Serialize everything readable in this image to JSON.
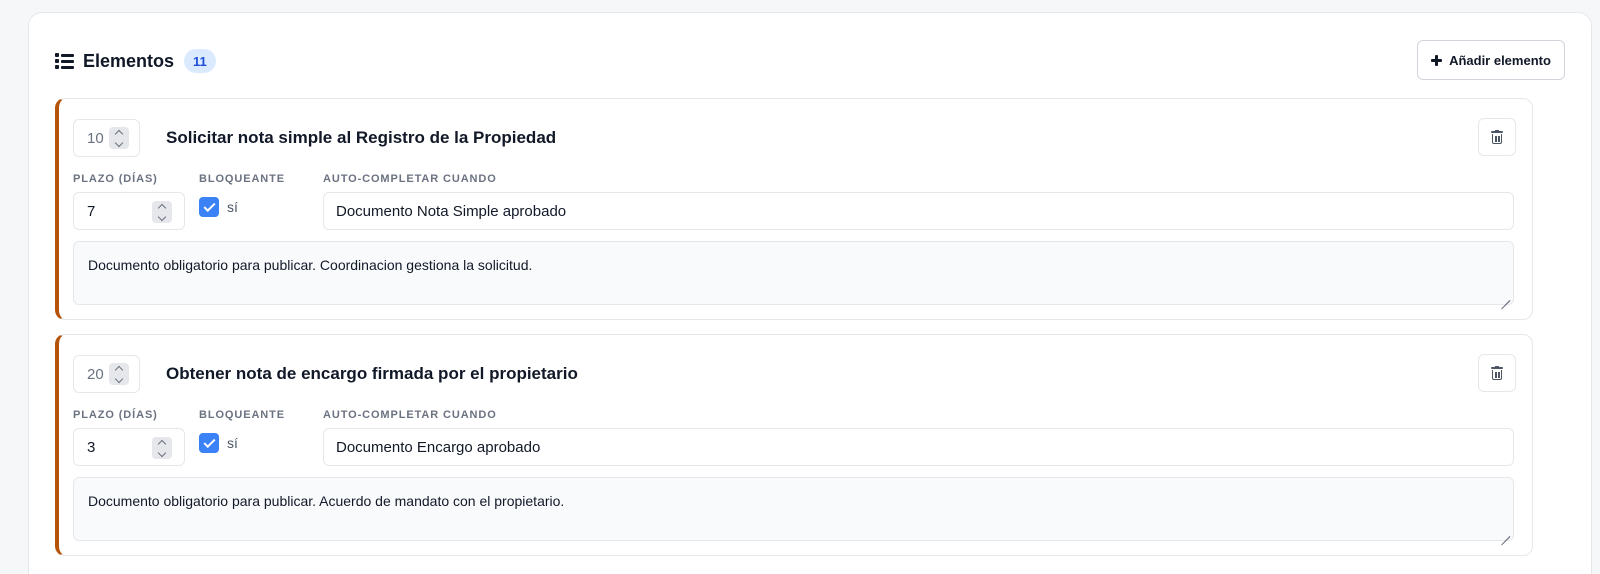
{
  "header": {
    "title": "Elementos",
    "count": "11",
    "add_label": "Añadir elemento",
    "icon": "list-icon"
  },
  "labels": {
    "plazo": "PLAZO (DÍAS)",
    "bloqueante": "BLOQUEANTE",
    "auto": "AUTO-COMPLETAR CUANDO"
  },
  "items": [
    {
      "order": "10",
      "title": "Solicitar nota simple al Registro de la Propiedad",
      "plazo": "7",
      "bloqueante": true,
      "bloqueante_label": "sí",
      "auto_completar": "Documento Nota Simple aprobado",
      "notes": "Documento obligatorio para publicar. Coordinacion gestiona la solicitud."
    },
    {
      "order": "20",
      "title": "Obtener nota de encargo firmada por el propietario",
      "plazo": "3",
      "bloqueante": true,
      "bloqueante_label": "sí",
      "auto_completar": "Documento Encargo aprobado",
      "notes": "Documento obligatorio para publicar. Acuerdo de mandato con el propietario."
    }
  ],
  "colors": {
    "accent_border": "#b45309",
    "checkbox": "#3b82f6",
    "badge_bg": "#dbeafe",
    "badge_text": "#1d4ed8"
  }
}
